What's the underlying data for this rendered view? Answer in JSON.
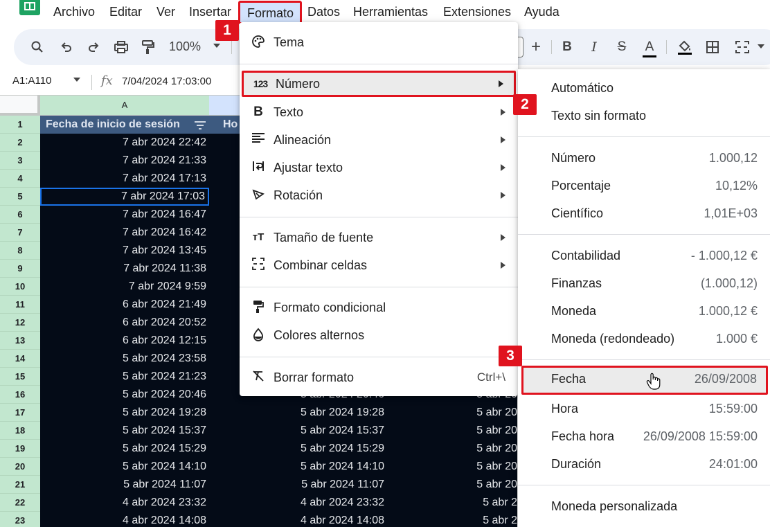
{
  "menubar": {
    "items": [
      "Archivo",
      "Editar",
      "Ver",
      "Insertar",
      "Formato",
      "Datos",
      "Herramientas",
      "Extensiones",
      "Ayuda"
    ]
  },
  "toolbar": {
    "zoom": "100%",
    "icons": [
      "search-icon",
      "undo-icon",
      "redo-icon",
      "print-icon",
      "paint-format-icon",
      "plus-icon",
      "bold-icon",
      "italic-icon",
      "strikethrough-icon",
      "text-color-icon",
      "fill-color-icon",
      "borders-icon",
      "merge-cells-icon"
    ]
  },
  "formula_bar": {
    "name_box": "A1:A110",
    "fx": "fx",
    "value": "7/04/2024 17:03:00"
  },
  "grid": {
    "column_headers": [
      "A"
    ],
    "header_a": "Fecha de inicio de sesión",
    "header_b": "Ho",
    "rows": [
      {
        "n": "1"
      },
      {
        "n": "2",
        "a": "7 abr 2024 22:42"
      },
      {
        "n": "3",
        "a": "7 abr 2024 21:33"
      },
      {
        "n": "4",
        "a": "7 abr 2024 17:13"
      },
      {
        "n": "5",
        "a": "7 abr 2024 17:03"
      },
      {
        "n": "6",
        "a": "7 abr 2024 16:47"
      },
      {
        "n": "7",
        "a": "7 abr 2024 16:42"
      },
      {
        "n": "8",
        "a": "7 abr 2024 13:45"
      },
      {
        "n": "9",
        "a": "7 abr 2024 11:38"
      },
      {
        "n": "10",
        "a": "7 abr 2024 9:59"
      },
      {
        "n": "11",
        "a": "6 abr 2024 21:49"
      },
      {
        "n": "12",
        "a": "6 abr 2024 20:52"
      },
      {
        "n": "13",
        "a": "6 abr 2024 12:15"
      },
      {
        "n": "14",
        "a": "5 abr 2024 23:58"
      },
      {
        "n": "15",
        "a": "5 abr 2024 21:23"
      },
      {
        "n": "16",
        "a": "5 abr 2024 20:46",
        "b": "5 abr 2024 20:46",
        "c": "5 abr 20"
      },
      {
        "n": "17",
        "a": "5 abr 2024 19:28",
        "b": "5 abr 2024 19:28",
        "c": "5 abr 20"
      },
      {
        "n": "18",
        "a": "5 abr 2024 15:37",
        "b": "5 abr 2024 15:37",
        "c": "5 abr 20"
      },
      {
        "n": "19",
        "a": "5 abr 2024 15:29",
        "b": "5 abr 2024 15:29",
        "c": "5 abr 20"
      },
      {
        "n": "20",
        "a": "5 abr 2024 14:10",
        "b": "5 abr 2024 14:10",
        "c": "5 abr 20"
      },
      {
        "n": "21",
        "a": "5 abr 2024 11:07",
        "b": "5 abr 2024 11:07",
        "c": "5 abr 20"
      },
      {
        "n": "22",
        "a": "4 abr 2024 23:32",
        "b": "4 abr 2024 23:32",
        "c": "5 abr 2"
      },
      {
        "n": "23",
        "a": "4 abr 2024 14:08",
        "b": "4 abr 2024 14:08",
        "c": "5 abr 2"
      }
    ]
  },
  "formato_menu": {
    "items": [
      {
        "icon": "palette-icon",
        "label": "Tema"
      },
      {
        "icon": "number-123-icon",
        "label": "Número",
        "submenu": true
      },
      {
        "icon": "bold-b-icon",
        "label": "Texto",
        "submenu": true
      },
      {
        "icon": "align-icon",
        "label": "Alineación",
        "submenu": true
      },
      {
        "icon": "wrap-text-icon",
        "label": "Ajustar texto",
        "submenu": true
      },
      {
        "icon": "rotation-icon",
        "label": "Rotación",
        "submenu": true
      },
      {
        "icon": "font-size-icon",
        "label": "Tamaño de fuente",
        "submenu": true
      },
      {
        "icon": "merge-cells-icon",
        "label": "Combinar celdas",
        "submenu": true
      },
      {
        "icon": "paint-roller-icon",
        "label": "Formato condicional"
      },
      {
        "icon": "drop-icon",
        "label": "Colores alternos"
      },
      {
        "icon": "clear-format-icon",
        "label": "Borrar formato",
        "shortcut": "Ctrl+\\"
      }
    ]
  },
  "numero_menu": {
    "items": [
      {
        "label": "Automático"
      },
      {
        "label": "Texto sin formato"
      },
      {
        "label": "Número",
        "example": "1.000,12"
      },
      {
        "label": "Porcentaje",
        "example": "10,12%"
      },
      {
        "label": "Científico",
        "example": "1,01E+03"
      },
      {
        "label": "Contabilidad",
        "example": "- 1.000,12 €"
      },
      {
        "label": "Finanzas",
        "example": "(1.000,12)"
      },
      {
        "label": "Moneda",
        "example": "1.000,12 €"
      },
      {
        "label": "Moneda (redondeado)",
        "example": "1.000 €"
      },
      {
        "label": "Fecha",
        "example": "26/09/2008"
      },
      {
        "label": "Hora",
        "example": "15:59:00"
      },
      {
        "label": "Fecha hora",
        "example": "26/09/2008 15:59:00"
      },
      {
        "label": "Duración",
        "example": "24:01:00"
      },
      {
        "label": "Moneda personalizada"
      }
    ]
  },
  "badges": [
    "1",
    "2",
    "3"
  ],
  "colors": {
    "highlight_red": "#e0131e",
    "cell_dark": "#040b17",
    "header_blue": "#3d5a80",
    "row_header_green": "#c2e7cf",
    "toolbar_bg": "#eef2f9"
  }
}
